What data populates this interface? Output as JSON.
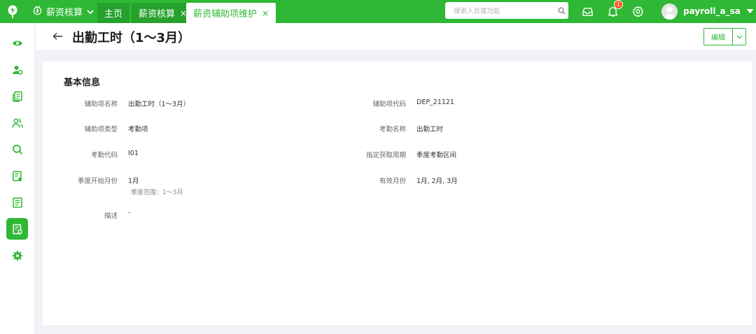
{
  "topbar": {
    "module": "薪资核算",
    "tabs": [
      {
        "label": "主页",
        "closable": false,
        "active": false
      },
      {
        "label": "薪资核算",
        "closable": true,
        "active": false
      },
      {
        "label": "薪资辅助项维护",
        "closable": true,
        "active": true
      }
    ],
    "close_glyph": "×",
    "search_placeholder": "搜索人员或功能",
    "notification_count": "1",
    "username": "payroll_a_sa",
    "icons": [
      "tree-logo-icon",
      "module-icon",
      "search-icon",
      "inbox-icon",
      "bell-icon",
      "gear-icon",
      "caret-down-icon"
    ]
  },
  "colors": {
    "brand": "#2fb835",
    "tab_inactive": "#26a12c",
    "badge": "#ff5a1f"
  },
  "sidebar": {
    "items": [
      {
        "icon": "eye-icon",
        "active": false
      },
      {
        "icon": "user-gear-icon",
        "active": false
      },
      {
        "icon": "documents-icon",
        "active": false
      },
      {
        "icon": "users-icon",
        "active": false
      },
      {
        "icon": "search-icon",
        "active": false
      },
      {
        "icon": "report-icon",
        "active": false
      },
      {
        "icon": "list-icon",
        "active": false
      },
      {
        "icon": "calc-settings-icon",
        "active": true
      },
      {
        "icon": "gear-icon",
        "active": false
      }
    ]
  },
  "header": {
    "title": "出勤工时（1～3月）",
    "edit_label": "编辑"
  },
  "card": {
    "section_title": "基本信息",
    "fields": {
      "name": {
        "label": "辅助项名称",
        "value": "出勤工时（1～3月）"
      },
      "code": {
        "label": "辅助项代码",
        "value": "DEP_21121"
      },
      "type": {
        "label": "辅助项类型",
        "value": "考勤项"
      },
      "attendance_name": {
        "label": "考勤名称",
        "value": "出勤工时"
      },
      "attendance_code": {
        "label": "考勤代码",
        "value": "I01"
      },
      "period": {
        "label": "指定获取周期",
        "value": "季度考勤区间"
      },
      "quarter_start": {
        "label": "季度开始月份",
        "value": "1月",
        "hint": "季度范围：1～3月"
      },
      "valid_months": {
        "label": "有效月份",
        "value": "1月, 2月, 3月"
      },
      "description": {
        "label": "描述",
        "value": "-"
      }
    }
  }
}
